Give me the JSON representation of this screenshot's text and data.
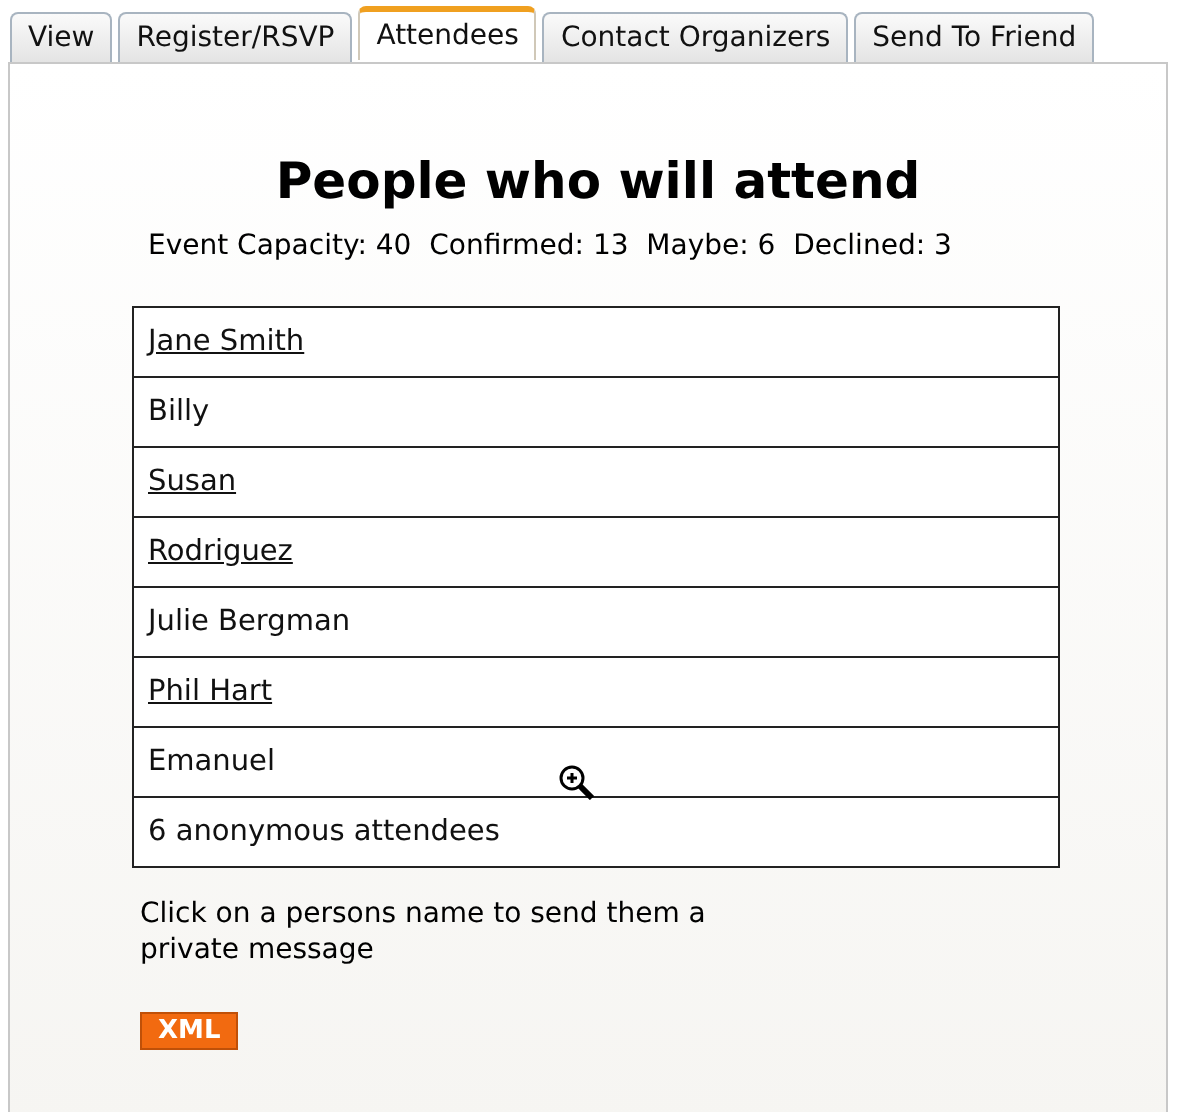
{
  "tabs": [
    {
      "label": "View",
      "selected": false
    },
    {
      "label": "Register/RSVP",
      "selected": false
    },
    {
      "label": "Attendees",
      "selected": true
    },
    {
      "label": "Contact Organizers",
      "selected": false
    },
    {
      "label": "Send To Friend",
      "selected": false
    }
  ],
  "heading": "People who will attend",
  "stats": "Event Capacity: 40  Confirmed: 13  Maybe: 6  Declined: 3",
  "attendees": [
    {
      "name": "Jane Smith",
      "linked": true
    },
    {
      "name": "Billy",
      "linked": false
    },
    {
      "name": "Susan",
      "linked": true
    },
    {
      "name": "Rodriguez",
      "linked": true
    },
    {
      "name": "Julie Bergman",
      "linked": false
    },
    {
      "name": "Phil Hart",
      "linked": true
    },
    {
      "name": "Emanuel",
      "linked": false
    },
    {
      "name": "6 anonymous attendees",
      "linked": false
    }
  ],
  "note": "Click on a persons name to send them a private message",
  "feed_badge": "XML"
}
